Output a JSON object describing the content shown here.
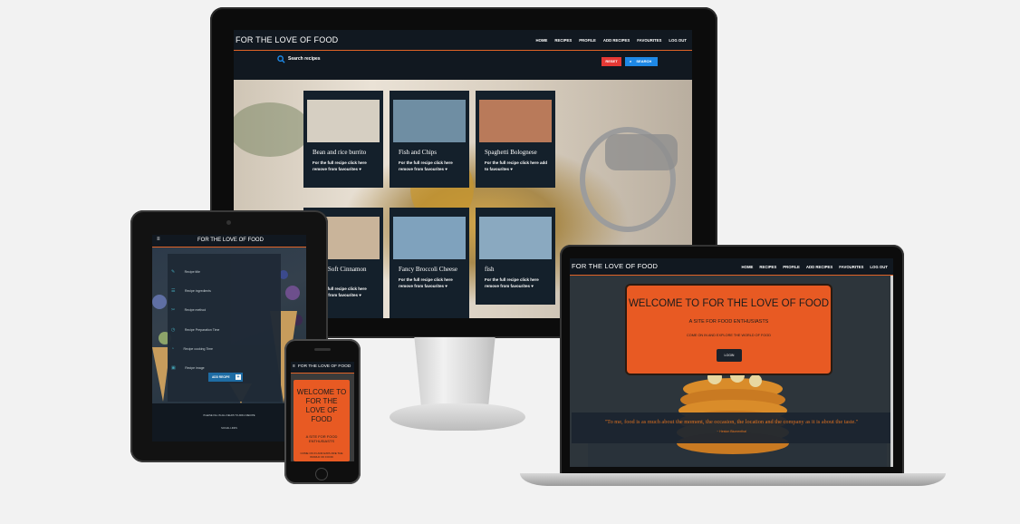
{
  "desktop": {
    "brand": "FOR THE LOVE OF FOOD",
    "nav": [
      "HOME",
      "RECIPES",
      "PROFILE",
      "ADD RECIPES",
      "FAVOURITES",
      "LOG OUT"
    ],
    "search_placeholder": "Search recipes",
    "reset_label": "RESET",
    "search_label": "SEARCH",
    "cards": [
      {
        "title": "Bean and rice burrito",
        "text": "For the full recipe click here remove from favourites ♥",
        "img_color": "#d6cfc2"
      },
      {
        "title": "Fish and Chips",
        "text": "For the full recipe click here remove from favourites ♥",
        "img_color": "#6f8ea3"
      },
      {
        "title": "Spaghetti Bolognese",
        "text": "For the full recipe click here add to favourites ♥",
        "img_color": "#b97a5a"
      },
      {
        "title": "Ooey Soft Cinnamon Rolls",
        "text": "For the full recipe click here remove from favourites ♥",
        "img_color": "#c9b49a"
      },
      {
        "title": "Fancy Broccoli Cheese",
        "text": "For the full recipe click here remove from favourites ♥",
        "img_color": "#7fa2bd"
      },
      {
        "title": "fish",
        "text": "For the full recipe click here remove from favourites ♥",
        "img_color": "#8aa9c0"
      }
    ]
  },
  "tablet": {
    "brand": "FOR THE LOVE OF FOOD",
    "menu": [
      "Recipe title",
      "Recipe ingredients",
      "Recipe method",
      "Recipe Preparation Time",
      "Recipe cooking Time",
      "Recipe image"
    ],
    "add_button": "ADD RECIPE",
    "footer_line1": "PLEASE FILL IN ALL FIELDS TO ADD A RECIPE",
    "footer_line2": "SOCIAL LINKS"
  },
  "phone": {
    "brand": "FOR THE LOVE OF FOOD",
    "hero_title": "WELCOME TO FOR THE LOVE OF FOOD",
    "hero_subtitle": "A SITE FOR FOOD ENTHUSIASTS",
    "hero_text": "COME ON IN AND EXPLORE THE WORLD OF FOOD"
  },
  "laptop": {
    "brand": "FOR THE LOVE OF FOOD",
    "nav": [
      "HOME",
      "RECIPES",
      "PROFILE",
      "ADD RECIPES",
      "FAVOURITES",
      "LOG OUT"
    ],
    "hero_title": "WELCOME TO FOR THE LOVE OF FOOD",
    "hero_subtitle": "A SITE FOR FOOD ENTHUSIASTS",
    "hero_text": "COME ON IN AND EXPLORE THE WORLD OF FOOD",
    "login_label": "LOGIN",
    "quote": "\"To me, food is as much about the moment, the occasion, the location and the company as it is about the taste.\"",
    "quote_author": "~ Heston Blumenthal"
  },
  "colors": {
    "accent": "#e05a2a",
    "navy": "#111820",
    "reset": "#e53935",
    "search": "#1e88e5"
  }
}
